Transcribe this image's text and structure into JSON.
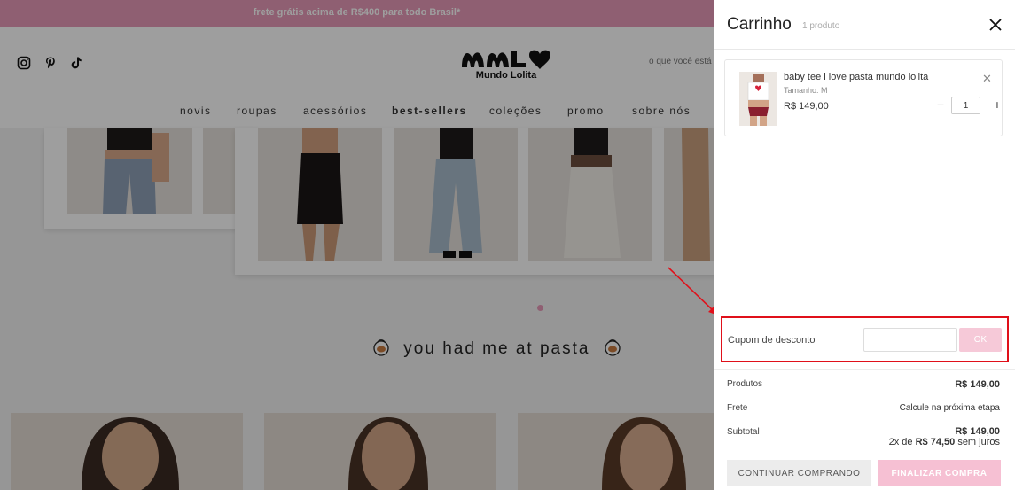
{
  "store": {
    "announcement": "frete grátis acima de R$400 para todo Brasil*",
    "logo_text": "Mundo Lolita",
    "search_placeholder": "o que você está",
    "social_icons": [
      "instagram-icon",
      "pinterest-icon",
      "tiktok-icon"
    ],
    "nav": [
      "novis",
      "roupas",
      "acessórios",
      "best-sellers",
      "coleções",
      "promo",
      "sobre nós"
    ],
    "tagline": "you had me at pasta",
    "accent_color": "#e79ab8"
  },
  "cart": {
    "title": "Carrinho",
    "count": "1 produto",
    "item": {
      "name": "baby tee i love pasta mundo lolita",
      "variant": "Tamanho: M",
      "price": "R$ 149,00",
      "quantity": "1"
    },
    "coupon": {
      "label": "Cupom de desconto",
      "input_value": "",
      "button": "OK"
    },
    "summary": {
      "products_label": "Produtos",
      "products_value": "R$ 149,00",
      "shipping_label": "Frete",
      "shipping_value": "Calcule na próxima etapa",
      "subtotal_label": "Subtotal",
      "subtotal_value": "R$ 149,00",
      "installments_prefix": "2x de",
      "installments_value": "R$ 74,50",
      "installments_suffix": "sem juros"
    },
    "continue_button": "CONTINUAR COMPRANDO",
    "checkout_button": "FINALIZAR COMPRA",
    "highlight_color": "#e0101a",
    "checkout_color": "#f6c0d3"
  }
}
